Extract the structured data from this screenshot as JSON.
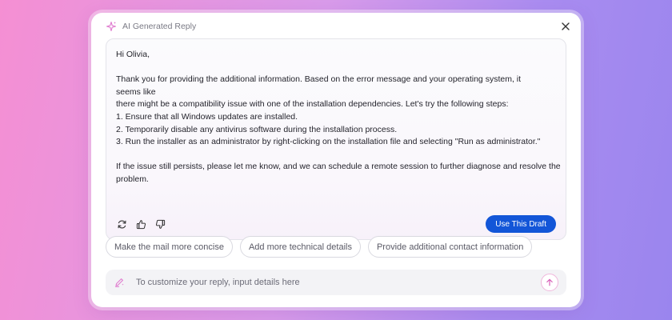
{
  "header": {
    "title": "AI Generated Reply",
    "icon": "sparkle-icon"
  },
  "draft": {
    "lines": [
      "Hi Olivia,",
      "",
      "Thank you for providing the additional information. Based on the error message and your operating system, it",
      "seems like",
      "there might be a compatibility issue with one of the installation dependencies. Let's try the following steps:",
      "1. Ensure that all Windows updates are installed.",
      "2. Temporarily disable any antivirus software during the installation process.",
      "3. Run the installer as an administrator by right-clicking on the installation file and selecting \"Run as administrator.\"",
      "",
      "If the issue still persists, please let me know, and we can schedule a remote session to further diagnose and resolve the",
      "problem."
    ],
    "use_button_label": "Use This Draft"
  },
  "suggestions": [
    "Make the mail more concise",
    "Add more technical details",
    "Provide additional contact information"
  ],
  "composer": {
    "placeholder": "To customize your reply, input details here",
    "value": ""
  },
  "colors": {
    "accent": "#1356d8",
    "sparkle": "#e07ccf"
  }
}
